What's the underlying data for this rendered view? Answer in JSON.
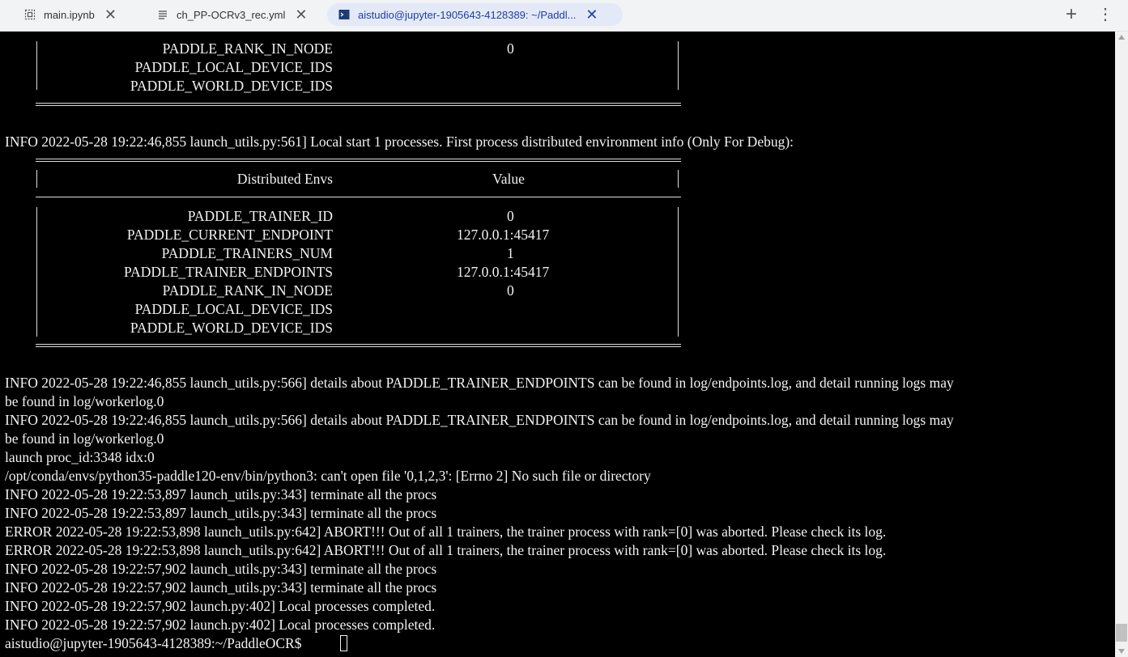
{
  "tabs": [
    {
      "label": "main.ipynb",
      "icon": "notebook-icon"
    },
    {
      "label": "ch_PP-OCRv3_rec.yml",
      "icon": "file-text-icon"
    },
    {
      "label": "aistudio@jupyter-1905643-4128389: ~/Paddl...",
      "icon": "terminal-icon"
    }
  ],
  "tabbar": {
    "close_glyph": "✕",
    "add_glyph": "+",
    "menu_glyph": "⋮"
  },
  "terminal": {
    "table1_rows": [
      {
        "key": "PADDLE_RANK_IN_NODE",
        "value": "0"
      },
      {
        "key": "PADDLE_LOCAL_DEVICE_IDS",
        "value": ""
      },
      {
        "key": "PADDLE_WORLD_DEVICE_IDS",
        "value": ""
      }
    ],
    "info_start": "INFO 2022-05-28 19:22:46,855 launch_utils.py:561] Local start 1 processes. First process distributed environment info (Only For Debug):",
    "table2_header": {
      "key": "Distributed Envs",
      "value": "Value"
    },
    "table2_rows": [
      {
        "key": "PADDLE_TRAINER_ID",
        "value": "0"
      },
      {
        "key": "PADDLE_CURRENT_ENDPOINT",
        "value": "127.0.0.1:45417"
      },
      {
        "key": "PADDLE_TRAINERS_NUM",
        "value": "1"
      },
      {
        "key": "PADDLE_TRAINER_ENDPOINTS",
        "value": "127.0.0.1:45417"
      },
      {
        "key": "PADDLE_RANK_IN_NODE",
        "value": "0"
      },
      {
        "key": "PADDLE_LOCAL_DEVICE_IDS",
        "value": ""
      },
      {
        "key": "PADDLE_WORLD_DEVICE_IDS",
        "value": ""
      }
    ],
    "log_lines": [
      "INFO 2022-05-28 19:22:46,855 launch_utils.py:566] details about PADDLE_TRAINER_ENDPOINTS can be found in log/endpoints.log, and detail running logs may",
      "be found in log/workerlog.0",
      "INFO 2022-05-28 19:22:46,855 launch_utils.py:566] details about PADDLE_TRAINER_ENDPOINTS can be found in log/endpoints.log, and detail running logs may",
      "be found in log/workerlog.0",
      "launch proc_id:3348 idx:0",
      "/opt/conda/envs/python35-paddle120-env/bin/python3: can't open file '0,1,2,3': [Errno 2] No such file or directory",
      "INFO 2022-05-28 19:22:53,897 launch_utils.py:343] terminate all the procs",
      "INFO 2022-05-28 19:22:53,897 launch_utils.py:343] terminate all the procs",
      "ERROR 2022-05-28 19:22:53,898 launch_utils.py:642] ABORT!!! Out of all 1 trainers, the trainer process with rank=[0] was aborted. Please check its log.",
      "ERROR 2022-05-28 19:22:53,898 launch_utils.py:642] ABORT!!! Out of all 1 trainers, the trainer process with rank=[0] was aborted. Please check its log.",
      "INFO 2022-05-28 19:22:57,902 launch_utils.py:343] terminate all the procs",
      "INFO 2022-05-28 19:22:57,902 launch_utils.py:343] terminate all the procs",
      "INFO 2022-05-28 19:22:57,902 launch.py:402] Local processes completed.",
      "INFO 2022-05-28 19:22:57,902 launch.py:402] Local processes completed."
    ],
    "prompt": "aistudio@jupyter-1905643-4128389:~/PaddleOCR$"
  }
}
